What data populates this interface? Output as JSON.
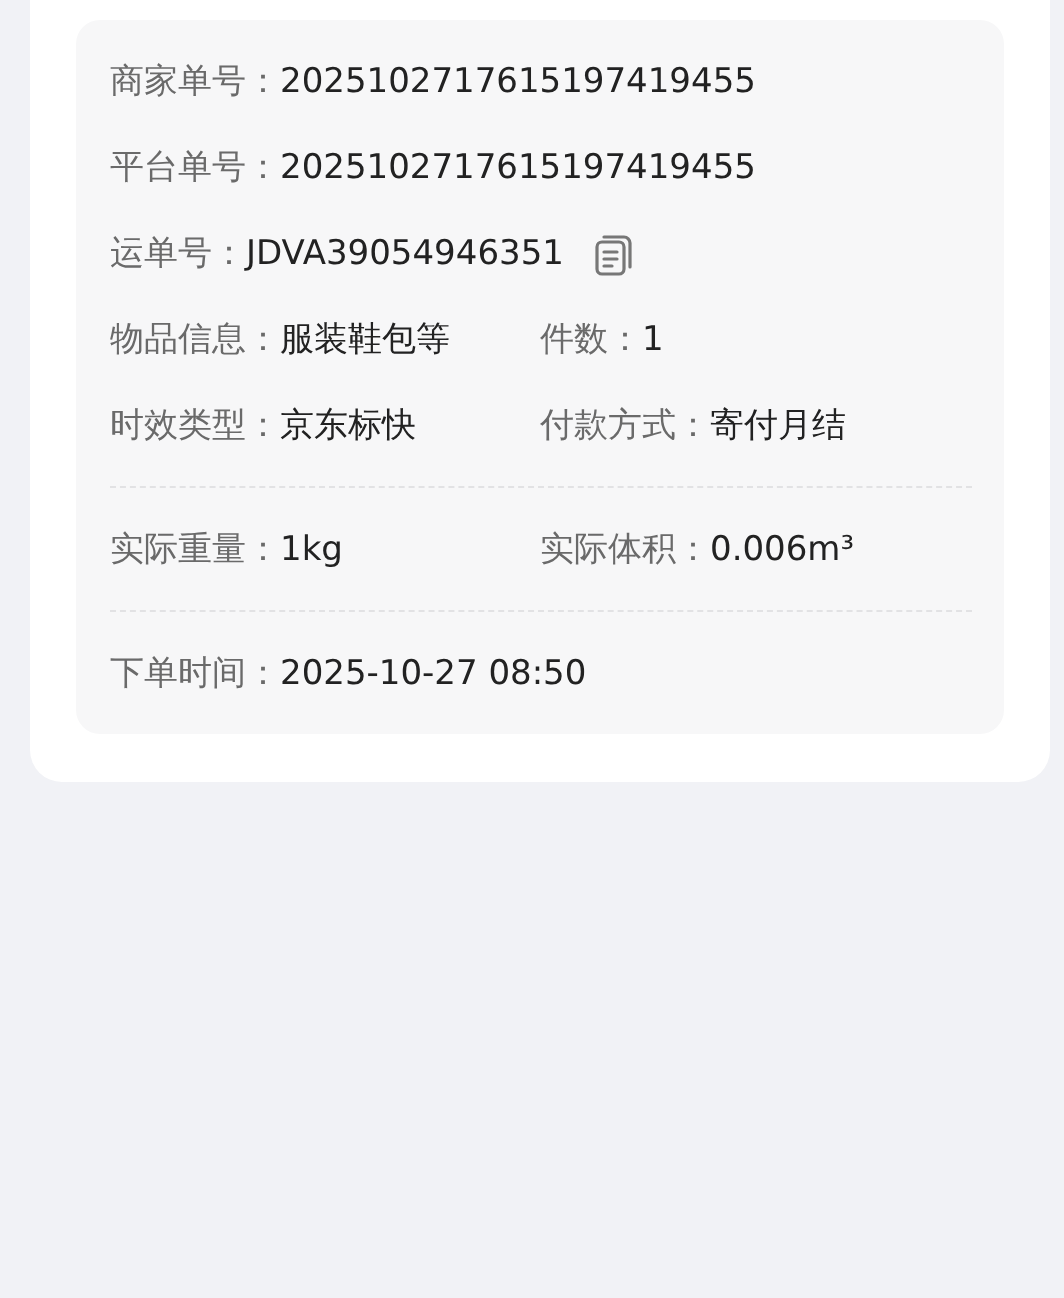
{
  "sections": [
    {
      "rows": [
        {
          "fields": [
            {
              "label": "商家单号：",
              "value": "2025102717615197419455",
              "copy": false
            }
          ]
        },
        {
          "fields": [
            {
              "label": "平台单号：",
              "value": "2025102717615197419455",
              "copy": false
            }
          ]
        },
        {
          "fields": [
            {
              "label": "运单号：",
              "value": "JDVA39054946351",
              "copy": true
            }
          ]
        },
        {
          "fields": [
            {
              "label": "物品信息：",
              "value": "服装鞋包等",
              "copy": false
            },
            {
              "label": "件数：",
              "value": "1",
              "copy": false
            }
          ]
        },
        {
          "fields": [
            {
              "label": "时效类型：",
              "value": "京东标快",
              "copy": false
            },
            {
              "label": "付款方式：",
              "value": "寄付月结",
              "copy": false
            }
          ]
        }
      ]
    },
    {
      "rows": [
        {
          "fields": [
            {
              "label": "实际重量：",
              "value": "1kg",
              "copy": false
            },
            {
              "label": "实际体积：",
              "value": "0.006m³",
              "copy": false
            }
          ]
        }
      ]
    },
    {
      "rows": [
        {
          "fields": [
            {
              "label": "下单时间：",
              "value": "2025-10-27 08:50",
              "copy": false
            }
          ]
        }
      ]
    }
  ]
}
